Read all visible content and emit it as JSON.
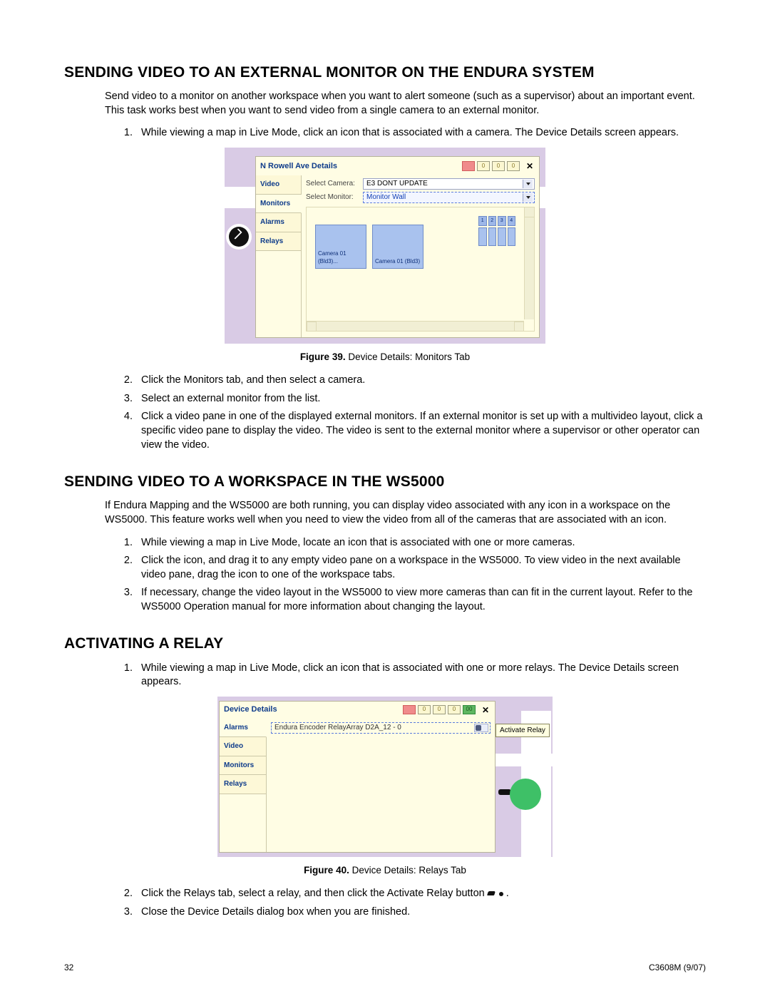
{
  "section1": {
    "heading": "SENDING VIDEO TO AN EXTERNAL MONITOR ON THE ENDURA SYSTEM",
    "intro": "Send video to a monitor on another workspace when you want to alert someone (such as a supervisor) about an important event. This task works best when you want to send video from a single camera to an external monitor.",
    "steps": {
      "s1": "While viewing a map in Live Mode, click an icon that is associated with a camera. The Device Details screen appears.",
      "s2": "Click the Monitors tab, and then select a camera.",
      "s3": "Select an external monitor from the list.",
      "s4": "Click a video pane in one of the displayed external monitors. If an external monitor is set up with a multivideo layout, click a specific video pane to display the video. The video is sent to the external monitor where a supervisor or other operator can view the video."
    }
  },
  "figure39": {
    "caption_bold": "Figure 39.",
    "caption_rest": "  Device Details: Monitors Tab",
    "panel_title": "N Rowell Ave Details",
    "sev1": "0",
    "sev2": "0",
    "sev3": "0",
    "tab_video": "Video",
    "tab_monitors": "Monitors",
    "tab_alarms": "Alarms",
    "tab_relays": "Relays",
    "lbl_camera": "Select Camera:",
    "val_camera": "E3 DONT UPDATE",
    "lbl_monitor": "Select Monitor:",
    "val_monitor": "Monitor Wall",
    "mon1": "Camera 01 (Bld3)...",
    "mon2": "Camera 01 (Bld3)",
    "g1": "1",
    "g2": "2",
    "g3": "3",
    "g4": "4"
  },
  "section2": {
    "heading": "SENDING VIDEO TO A WORKSPACE IN THE WS5000",
    "intro": "If Endura Mapping and the WS5000 are both running, you can display video associated with any icon in a workspace on the WS5000. This feature works well when you need to view the video from all of the cameras that are associated with an icon.",
    "steps": {
      "s1": "While viewing a map in Live Mode, locate an icon that is associated with one or more cameras.",
      "s2": "Click the icon, and drag it to any empty video pane on a workspace in the WS5000. To view video in the next available video pane, drag the icon to one of the workspace tabs.",
      "s3": "If necessary, change the video layout in the WS5000 to view more cameras than can fit in the current layout. Refer to the WS5000 Operation manual for more information about changing the layout."
    }
  },
  "section3": {
    "heading": "ACTIVATING A RELAY",
    "steps": {
      "s1": "While viewing a map in Live Mode, click an icon that is associated with one or more relays. The Device Details screen appears.",
      "s2a": "Click the Relays tab, select a relay, and then click the Activate Relay button ",
      "s2b": ".",
      "s3": "Close the Device Details dialog box when you are finished."
    }
  },
  "figure40": {
    "caption_bold": "Figure 40.",
    "caption_rest": "  Device Details: Relays Tab",
    "panel_title": "Device Details",
    "sev1": "0",
    "sev2": "0",
    "sev3": "0",
    "sev4": "00",
    "tab_alarms": "Alarms",
    "tab_video": "Video",
    "tab_monitors": "Monitors",
    "tab_relays": "Relays",
    "relay_name": "Endura Encoder RelayArray D2A_12 - 0",
    "tooltip": "Activate Relay"
  },
  "footer": {
    "page": "32",
    "doc": "C3608M (9/07)"
  }
}
